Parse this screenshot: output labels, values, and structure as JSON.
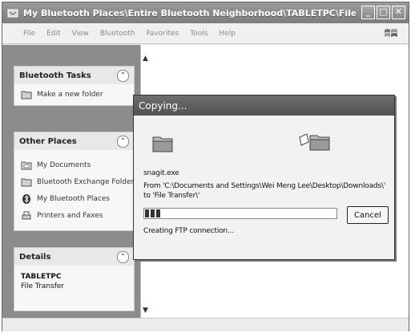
{
  "window": {
    "title": "My Bluetooth Places\\Entire Bluetooth Neighborhood\\TABLETPC\\File Transfer"
  },
  "menu": [
    "File",
    "Edit",
    "View",
    "Bluetooth",
    "Favorites",
    "Tools",
    "Help"
  ],
  "sidebar": {
    "tasks": {
      "heading": "Bluetooth Tasks",
      "items": [
        {
          "label": "Make a new folder",
          "icon": "new-folder-icon"
        }
      ]
    },
    "other_places": {
      "heading": "Other Places",
      "items": [
        {
          "label": "My Documents",
          "icon": "my-documents-icon"
        },
        {
          "label": "Bluetooth Exchange Folder",
          "icon": "folder-icon"
        },
        {
          "label": "My Bluetooth Places",
          "icon": "bluetooth-icon"
        },
        {
          "label": "Printers and Faxes",
          "icon": "printer-icon"
        }
      ]
    },
    "details": {
      "heading": "Details",
      "name": "TABLETPC",
      "type": "File Transfer"
    }
  },
  "dialog": {
    "title": "Copying...",
    "filename": "snagit.exe",
    "from_line": "From 'C:\\Documents and Settings\\Wei Meng Lee\\Desktop\\Downloads\\'",
    "to_line": "to 'File Transfer\\'",
    "status": "Creating FTP connection...",
    "cancel_label": "Cancel",
    "progress_fraction": 0.08
  }
}
